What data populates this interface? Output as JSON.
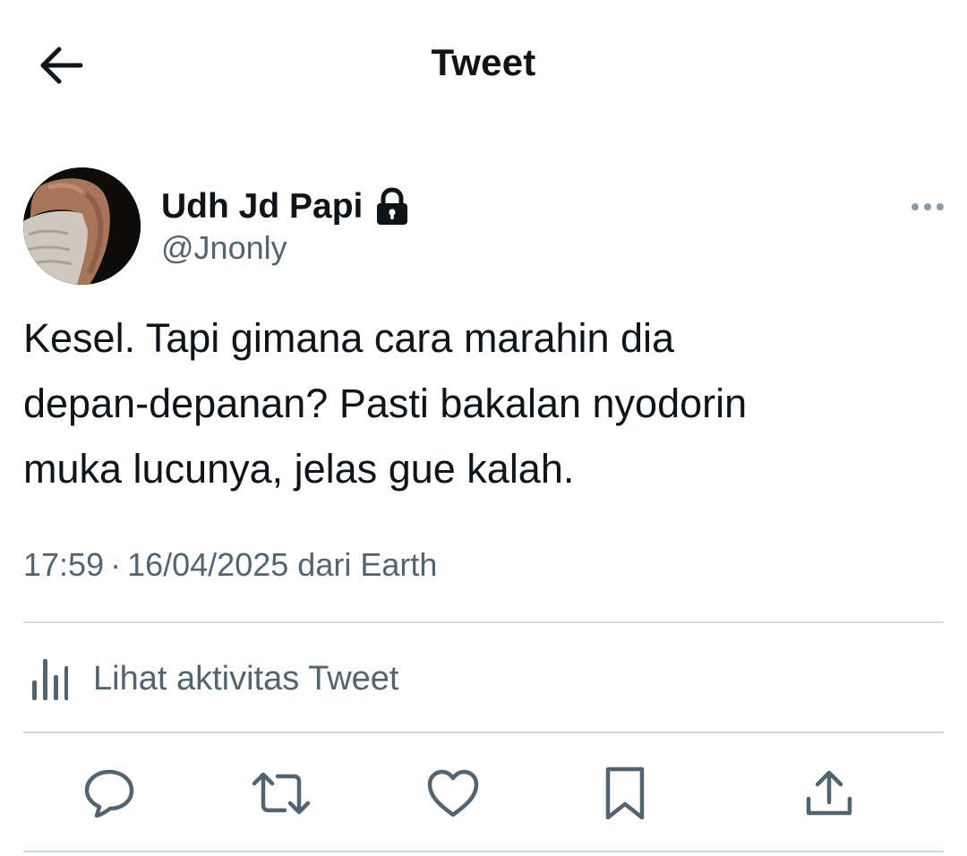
{
  "header": {
    "title": "Tweet",
    "back_icon": "arrow-left-icon"
  },
  "author": {
    "display_name": "Udh Jd Papi",
    "handle": "@Jnonly",
    "protected_icon": "lock-icon",
    "more_icon": "more-horizontal-icon"
  },
  "tweet": {
    "lines": [
      "Kesel. Tapi gimana cara marahin dia",
      "depan-depanan? Pasti bakalan nyodorin",
      "muka lucunya, jelas gue kalah."
    ],
    "time": "17:59",
    "separator": "·",
    "date": "16/04/2025",
    "source": "dari Earth"
  },
  "activity": {
    "label": "Lihat aktivitas Tweet",
    "icon": "bar-chart-icon"
  },
  "actions": [
    {
      "name": "reply",
      "icon": "reply-icon"
    },
    {
      "name": "retweet",
      "icon": "retweet-icon"
    },
    {
      "name": "like",
      "icon": "heart-icon"
    },
    {
      "name": "bookmark",
      "icon": "bookmark-icon"
    },
    {
      "name": "share",
      "icon": "share-icon"
    }
  ],
  "colors": {
    "text": "#0f1419",
    "secondary": "#536471",
    "divider": "#cfd9de",
    "background": "#ffffff"
  }
}
